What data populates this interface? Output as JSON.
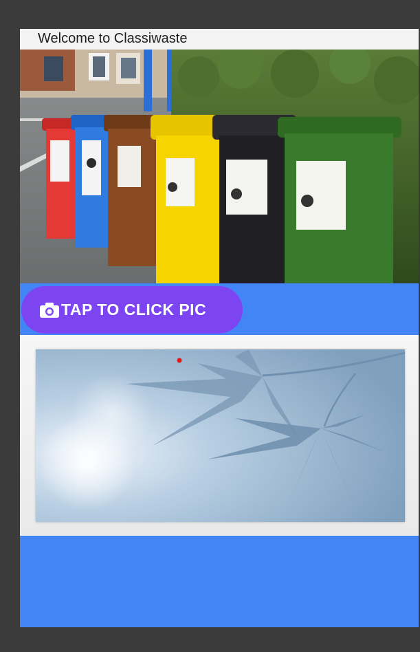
{
  "app": {
    "title": "Welcome to Classiwaste"
  },
  "hero": {
    "image_subject": "row of colored recycling wheelie bins",
    "bin_colors": [
      "#e53935",
      "#2f7be0",
      "#8a4a22",
      "#f6d400",
      "#1f1f24",
      "#3a7a2c"
    ]
  },
  "capture": {
    "icon": "camera-icon",
    "label": "TAP TO CLICK PIC",
    "button_color": "#7d45f1"
  },
  "preview": {
    "image_subject": "blue-tinted maple leaf placeholder",
    "marker_color": "#e0191b"
  },
  "colors": {
    "accent": "#4285f4",
    "frame": "#3b3b3b"
  }
}
